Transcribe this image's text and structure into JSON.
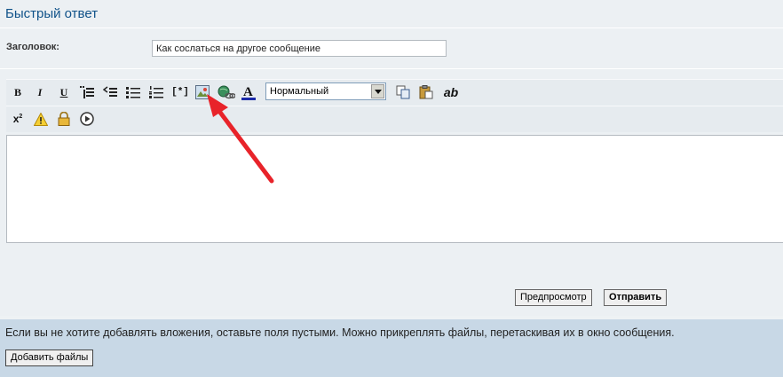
{
  "form": {
    "title": "Быстрый ответ",
    "subject_label": "Заголовок:",
    "subject_value": "Как сослаться на другое сообщение"
  },
  "toolbar": {
    "bold": "B",
    "italic": "I",
    "underline": "U",
    "list_item": "[*]",
    "superscript_base": "x",
    "superscript_exp": "2",
    "ab": "ab",
    "font_size_selected": "Нормальный",
    "icons": [
      "bold-icon",
      "italic-icon",
      "underline-icon",
      "quote-icon",
      "code-icon",
      "bullet-list-icon",
      "numbered-list-icon",
      "list-item-icon",
      "image-icon",
      "link-icon",
      "font-color-icon",
      "copy-icon",
      "paste-icon",
      "spelling-icon",
      "superscript-icon",
      "warning-icon",
      "lock-icon",
      "play-icon"
    ]
  },
  "buttons": {
    "preview": "Предпросмотр",
    "submit": "Отправить"
  },
  "attachments": {
    "notice": "Если вы не хотите добавлять вложения, оставьте поля пустыми. Можно прикреплять файлы, перетаскивая их в окно сообщения.",
    "add_files": "Добавить файлы"
  },
  "colors": {
    "title": "#105289",
    "panel_bg": "#ecf0f3",
    "attach_bg": "#c8d8e6",
    "annotation_arrow": "#e8232a"
  }
}
